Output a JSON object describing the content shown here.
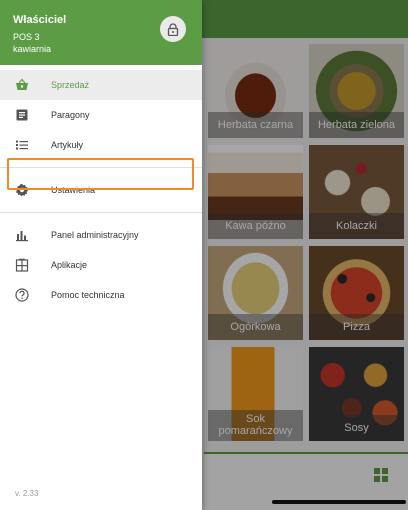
{
  "drawer": {
    "user_name": "Właściciel",
    "pos_name": "POS 3",
    "place_name": "kawiarnia",
    "version": "v. 2.33",
    "items": [
      {
        "label": "Sprzedaż",
        "icon": "basket-icon",
        "active": true
      },
      {
        "label": "Paragony",
        "icon": "receipt-icon"
      },
      {
        "label": "Artykuły",
        "icon": "list-icon"
      },
      {
        "label": "Ustawienia",
        "icon": "gear-icon",
        "highlighted": true
      },
      {
        "label": "Panel administracyjny",
        "icon": "bar-chart-icon"
      },
      {
        "label": "Aplikacje",
        "icon": "apps-icon"
      },
      {
        "label": "Pomoc techniczna",
        "icon": "help-icon"
      }
    ]
  },
  "products": [
    {
      "label": "Herbata czarna"
    },
    {
      "label": "Herbata zielona"
    },
    {
      "label": "Kawa późno"
    },
    {
      "label": "Kolaczki"
    },
    {
      "label": "Ogórkowa"
    },
    {
      "label": "Pizza"
    },
    {
      "label": "Sok pomarańczowy"
    },
    {
      "label": "Sosy"
    }
  ],
  "colors": {
    "brand_green": "#5c9c45",
    "highlight_orange": "#ef8a2e"
  }
}
